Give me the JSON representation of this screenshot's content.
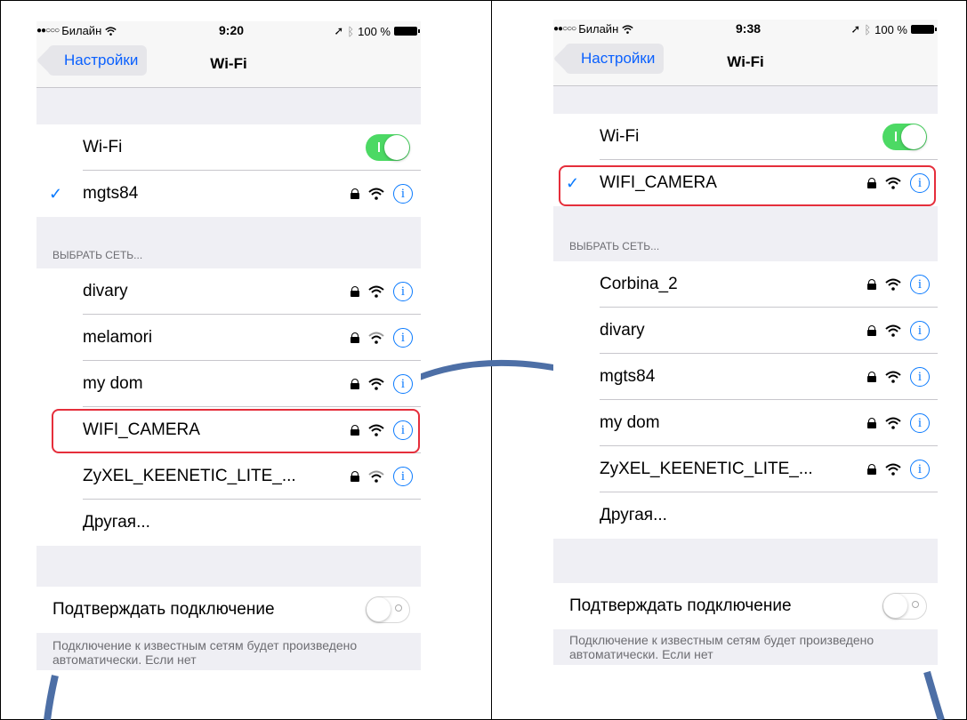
{
  "left": {
    "status": {
      "carrier": "Билайн",
      "time": "9:20",
      "battery": "100 %"
    },
    "nav": {
      "back_label": "Настройки",
      "title": "Wi-Fi"
    },
    "wifi_label": "Wi-Fi",
    "connected": "mgts84",
    "choose_header": "ВЫБРАТЬ СЕТЬ...",
    "networks": [
      "divary",
      "melamori",
      "my dom",
      "WIFI_CAMERA",
      "ZyXEL_KEENETIC_LITE_..."
    ],
    "other": "Другая...",
    "ask_label": "Подтверждать подключение",
    "footer": "Подключение к известным сетям будет произведено автоматически. Если нет"
  },
  "right": {
    "status": {
      "carrier": "Билайн",
      "time": "9:38",
      "battery": "100 %"
    },
    "nav": {
      "back_label": "Настройки",
      "title": "Wi-Fi"
    },
    "wifi_label": "Wi-Fi",
    "connected": "WIFI_CAMERA",
    "choose_header": "ВЫБРАТЬ СЕТЬ...",
    "networks": [
      "Corbina_2",
      "divary",
      "mgts84",
      "my dom",
      "ZyXEL_KEENETIC_LITE_..."
    ],
    "other": "Другая...",
    "ask_label": "Подтверждать подключение",
    "footer": "Подключение к известным сетям будет произведено автоматически. Если нет"
  },
  "colors": {
    "accent": "#0a7afe",
    "toggle_on": "#4cd964",
    "highlight": "#e52e3b",
    "arc": "#4d6fa6"
  },
  "icons": {
    "lock": "lock-icon",
    "wifi": "wifi-signal-icon",
    "info": "info-icon",
    "check": "checkmark-icon",
    "bluetooth": "bluetooth-icon",
    "location": "location-arrow-icon"
  }
}
